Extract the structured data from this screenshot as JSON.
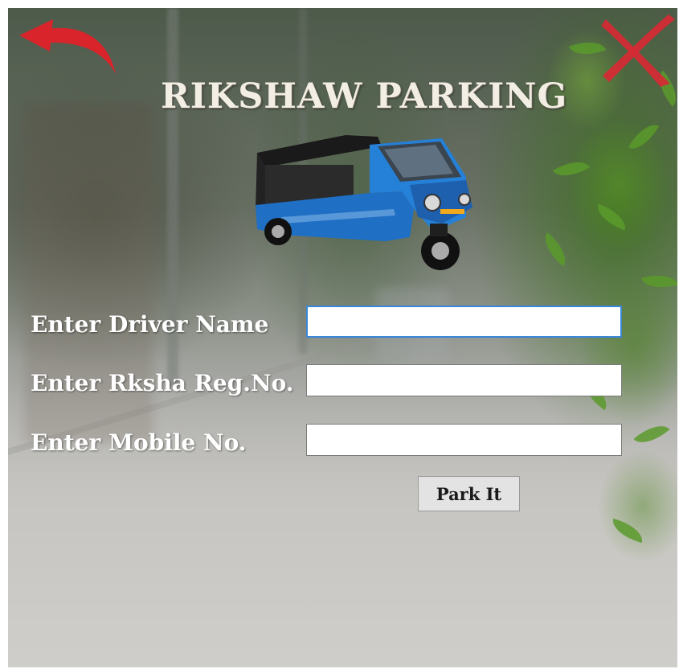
{
  "window": {
    "title": "RIKSHAW PARKING"
  },
  "icons": {
    "back": "back-arrow-icon",
    "close": "close-x-icon",
    "vehicle": "electric-rickshaw-image"
  },
  "form": {
    "driver_name_label": "Enter Driver Name",
    "driver_name_value": "",
    "reg_no_label": "Enter Rksha Reg.No.",
    "reg_no_value": "",
    "mobile_label": "Enter Mobile No.",
    "mobile_value": "",
    "submit_label": "Park It"
  },
  "colors": {
    "back_arrow": "#d8242a",
    "close_x": "#d62a34",
    "rickshaw_body": "#1f6fc4",
    "title_text": "#f3eee4"
  }
}
